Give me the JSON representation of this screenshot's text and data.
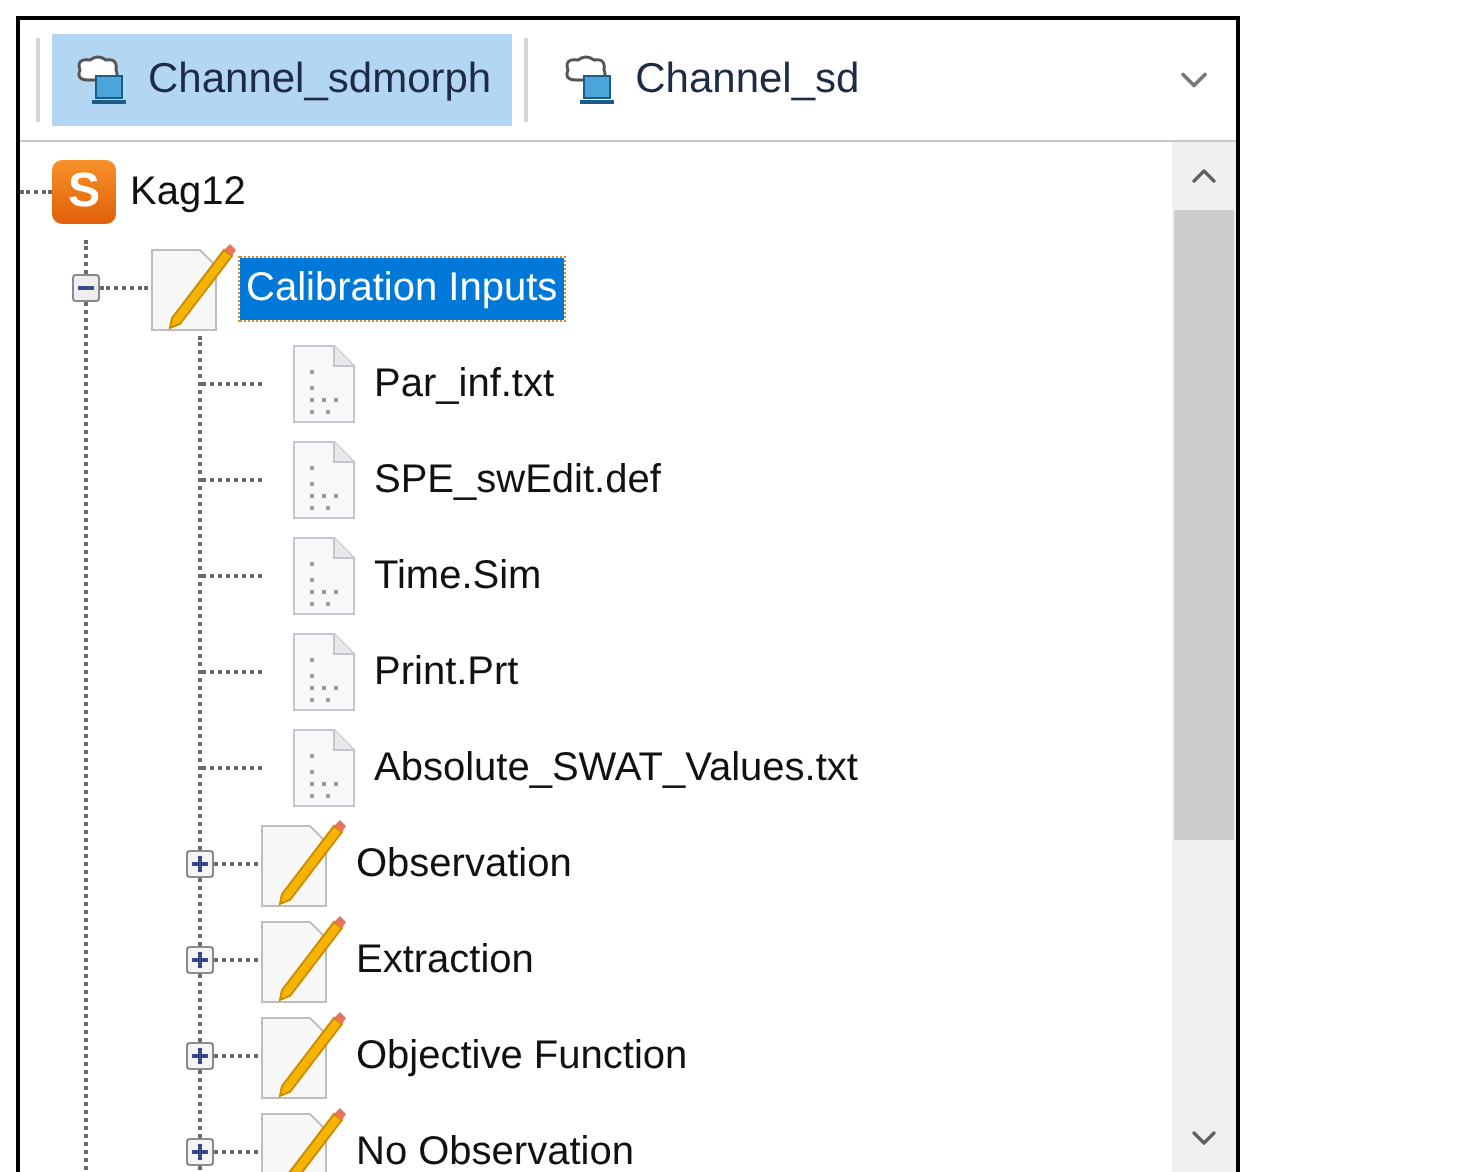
{
  "tabs": [
    {
      "label": "Channel_sdmorph",
      "selected": true
    },
    {
      "label": "Channel_sd",
      "selected": false
    }
  ],
  "tree": [
    {
      "label": "Kag12",
      "kind": "project",
      "badge": "S",
      "selected": false,
      "children": [
        {
          "label": "Calibration Inputs",
          "kind": "folder",
          "selected": true,
          "expanded": true,
          "children": [
            {
              "label": "Par_inf.txt",
              "kind": "file",
              "selected": false
            },
            {
              "label": "SPE_swEdit.def",
              "kind": "file",
              "selected": false
            },
            {
              "label": "Time.Sim",
              "kind": "file",
              "selected": false
            },
            {
              "label": "Print.Prt",
              "kind": "file",
              "selected": false
            },
            {
              "label": "Absolute_SWAT_Values.txt",
              "kind": "file",
              "selected": false
            },
            {
              "label": "Observation",
              "kind": "folder",
              "selected": false,
              "expanded": false
            },
            {
              "label": "Extraction",
              "kind": "folder",
              "selected": false,
              "expanded": false
            },
            {
              "label": "Objective Function",
              "kind": "folder",
              "selected": false,
              "expanded": false
            },
            {
              "label": "No Observation",
              "kind": "folder",
              "selected": false,
              "expanded": false
            }
          ]
        }
      ]
    }
  ]
}
